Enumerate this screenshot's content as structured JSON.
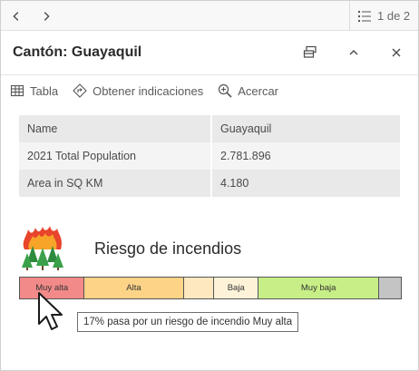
{
  "nav": {
    "pager_text": "1 de 2"
  },
  "header": {
    "title": "Cantón: Guayaquil"
  },
  "actions": [
    {
      "label": "Tabla",
      "icon": "table-icon"
    },
    {
      "label": "Obtener indicaciones",
      "icon": "directions-icon"
    },
    {
      "label": "Acercar",
      "icon": "zoom-in-icon"
    }
  ],
  "table": {
    "rows": [
      {
        "field": "Name",
        "value": "Guayaquil"
      },
      {
        "field": "2021 Total Population",
        "value": "2.781.896"
      },
      {
        "field": "Area in SQ KM",
        "value": "4.180"
      }
    ]
  },
  "fire": {
    "title": "Riesgo de incendios",
    "segments": [
      {
        "label": "Muy alta",
        "color": "#f28a8a",
        "share": 0.17
      },
      {
        "label": "Alta",
        "color": "#fdd487",
        "share": 0.26
      },
      {
        "label": "",
        "color": "#fde8c0",
        "share": 0.08
      },
      {
        "label": "Baja",
        "color": "#fef3d8",
        "share": 0.117
      },
      {
        "label": "Muy baja",
        "color": "#c8ef87",
        "share": 0.316
      },
      {
        "label": "",
        "color": "#c4c4c4",
        "share": 0.057
      }
    ],
    "tooltip": "17% pasa por un riesgo de incendio Muy alta"
  }
}
